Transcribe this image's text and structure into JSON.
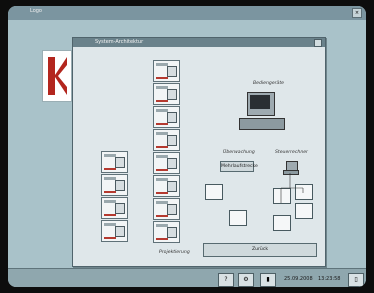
{
  "screen": {
    "title": "Logo",
    "close_label": "×"
  },
  "window": {
    "title": "System-Architektur",
    "close_label": "×"
  },
  "diagram": {
    "bediengerate": "Bediengeräte",
    "uberwachung": "Überwachung",
    "steuerrechner": "Steuerrechner",
    "mehrlauf": "Mehrlaufstrecke",
    "projektierung": "Projektierung"
  },
  "buttons": {
    "zuruck": "Zurück"
  },
  "taskbar": {
    "icon1": "?",
    "icon2": "⚙",
    "icon3": "▮",
    "date": "25.09.2008",
    "time": "13:23:58",
    "icon4": "▯"
  },
  "colors": {
    "accent": "#b53a30",
    "background": "#a9c2c9"
  }
}
